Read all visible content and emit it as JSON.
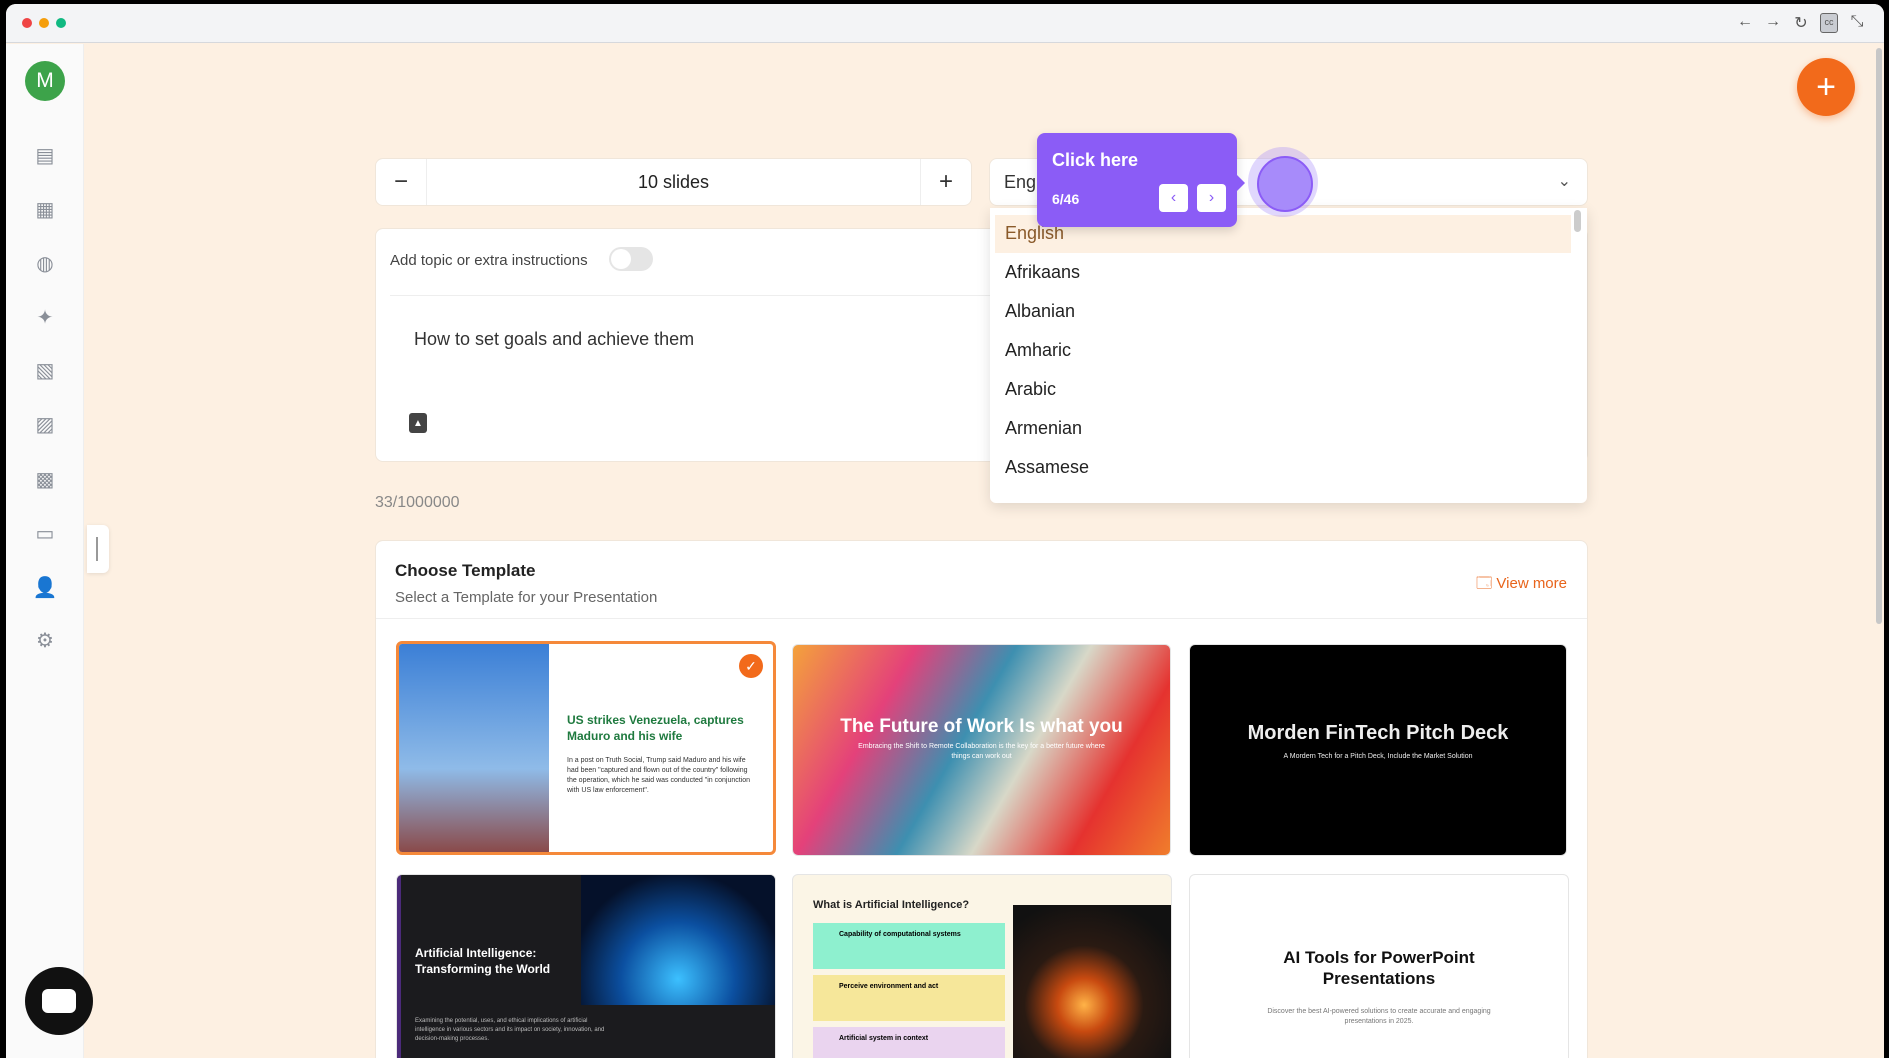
{
  "window": {
    "controls": [
      "close",
      "minimize",
      "maximize"
    ],
    "toolbar_icons": [
      "back-icon",
      "forward-icon",
      "reload-icon",
      "captions-icon",
      "collapse-icon"
    ]
  },
  "sidebar": {
    "avatar_letter": "M",
    "items": [
      "presentation",
      "layout",
      "palette",
      "sparkles",
      "chart-board",
      "image",
      "apps",
      "video",
      "add-user",
      "settings"
    ]
  },
  "slides": {
    "value": "10 slides",
    "minus": "−",
    "plus": "+"
  },
  "language": {
    "value": "Eng",
    "options": [
      "English",
      "Afrikaans",
      "Albanian",
      "Amharic",
      "Arabic",
      "Armenian",
      "Assamese"
    ],
    "selected": "English"
  },
  "tooltip": {
    "title": "Click here",
    "step": "6/46"
  },
  "topic": {
    "label": "Add topic or extra instructions",
    "text": "How to set goals and achieve them",
    "toggle_on": false,
    "counter": "33/1000000"
  },
  "templates": {
    "title": "Choose Template",
    "subtitle": "Select a Template for your Presentation",
    "view_more": "View more",
    "cards": [
      {
        "title": "US strikes Venezuela, captures Maduro and his wife",
        "body": "In a post on Truth Social, Trump said Maduro and his wife had been \"captured and flown out of the country\" following the operation, which he said was conducted \"in conjunction with US law enforcement\".",
        "selected": true
      },
      {
        "title": "The Future of Work Is what you",
        "body": "Embracing the Shift to Remote Collaboration is the key for a better future where things can work out"
      },
      {
        "title": "Morden FinTech Pitch Deck",
        "body": "A Mordern Tech for a Pitch Deck, Include the Market Solution"
      },
      {
        "title": "Artificial Intelligence: Transforming the World",
        "body": "Examining the potential, uses, and ethical implications of artificial intelligence in various sectors and its impact on society, innovation, and decision-making processes."
      },
      {
        "title": "What is Artificial Intelligence?",
        "items": [
          "Capability of computational systems",
          "Perceive environment and act",
          "Artificial system in context"
        ]
      },
      {
        "title": "AI Tools for PowerPoint Presentations",
        "body": "Discover the best AI-powered solutions to create accurate and engaging presentations in 2025."
      }
    ]
  },
  "colors": {
    "accent": "#f26a1b",
    "tour": "#8b5cf6",
    "background": "#fdf0e2"
  }
}
